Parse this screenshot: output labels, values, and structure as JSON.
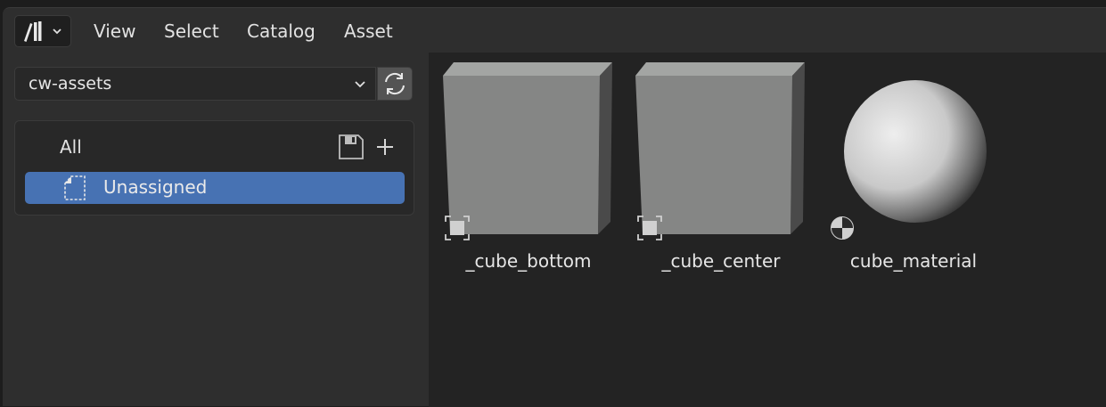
{
  "header": {
    "editor_type_icon": "asset-library-icon",
    "menu": [
      {
        "label": "View"
      },
      {
        "label": "Select"
      },
      {
        "label": "Catalog"
      },
      {
        "label": "Asset"
      }
    ]
  },
  "sidebar": {
    "library": {
      "value": "cw-assets",
      "refresh_icon": "refresh-icon"
    },
    "catalogs": {
      "all_label": "All",
      "items": [
        {
          "label": "Unassigned",
          "icon": "unassigned-catalog-icon",
          "selected": true
        }
      ]
    }
  },
  "assets": [
    {
      "name": "_cube_bottom",
      "type_icon": "object-icon"
    },
    {
      "name": "_cube_center",
      "type_icon": "object-icon"
    },
    {
      "name": "cube_material",
      "type_icon": "material-icon"
    }
  ],
  "colors": {
    "accent": "#4772b3",
    "panel": "#2e2e2e",
    "browser_bg": "#232323"
  }
}
